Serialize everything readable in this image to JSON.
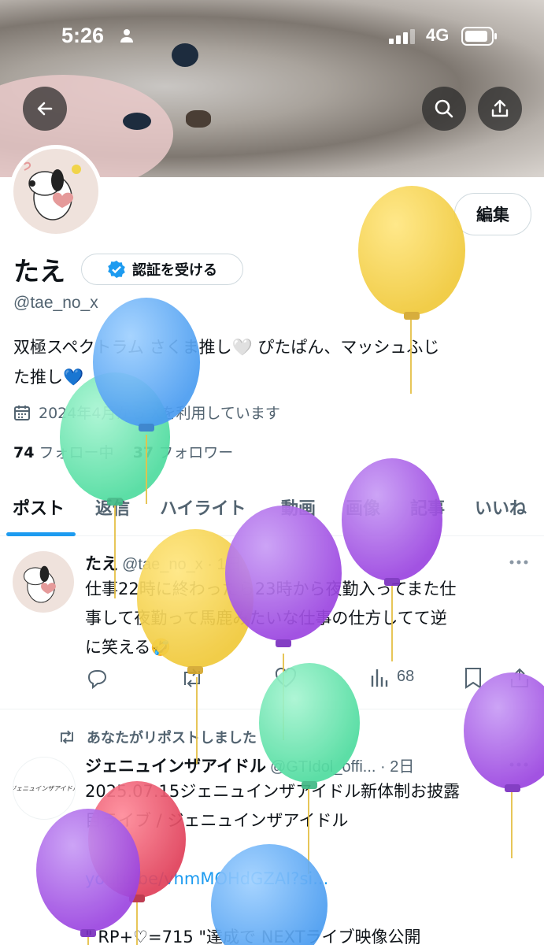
{
  "status_bar": {
    "time": "5:26",
    "network": "4G"
  },
  "header": {
    "back_icon": "arrow-left-icon",
    "search_icon": "search-icon",
    "share_icon": "share-icon"
  },
  "profile": {
    "edit_label": "編集",
    "name": "たえ",
    "verify_label": "認証を受ける",
    "handle": "@tae_no_x",
    "bio_line1": "双極スペクトラム さくま推し🤍 ぴたぱん、マッシュふじ",
    "bio_line2": "た推し💙",
    "joined": "2024年4月から Xを利用しています",
    "following_count": "74",
    "following_label": "フォロー中",
    "followers_count": "37",
    "followers_label": "フォロワー"
  },
  "tabs": [
    "ポスト",
    "返信",
    "ハイライト",
    "動画",
    "画像",
    "記事",
    "いいね"
  ],
  "posts": [
    {
      "name": "たえ",
      "meta": "@tae_no_x · 1日",
      "text_line1": "仕事22時に終わったら23時から夜勤入ってまた仕",
      "text_line2": "事して夜勤って馬鹿みたいな仕事の仕方してて逆",
      "text_line3": "に笑える🤣",
      "views": "68"
    },
    {
      "repost_label": "あなたがリポストしました",
      "name": "ジェニュインザアイドル",
      "meta": "@GTIdol_offi... · 2日",
      "avatar_text": "ジェニュインザアイドル",
      "text_line1": "2025.07.15ジェニュインザアイドル新体制お披露",
      "text_line2": "目ライブ / ジェニュインザアイドル",
      "link": "youtu.be/vhmMOHdGZAI?si...",
      "text_line4": "\" RP+♡=715 \"達成で NEXTライブ映像公開"
    }
  ],
  "colors": {
    "accent": "#1d9bf0",
    "verify": "#1d9bf0"
  }
}
